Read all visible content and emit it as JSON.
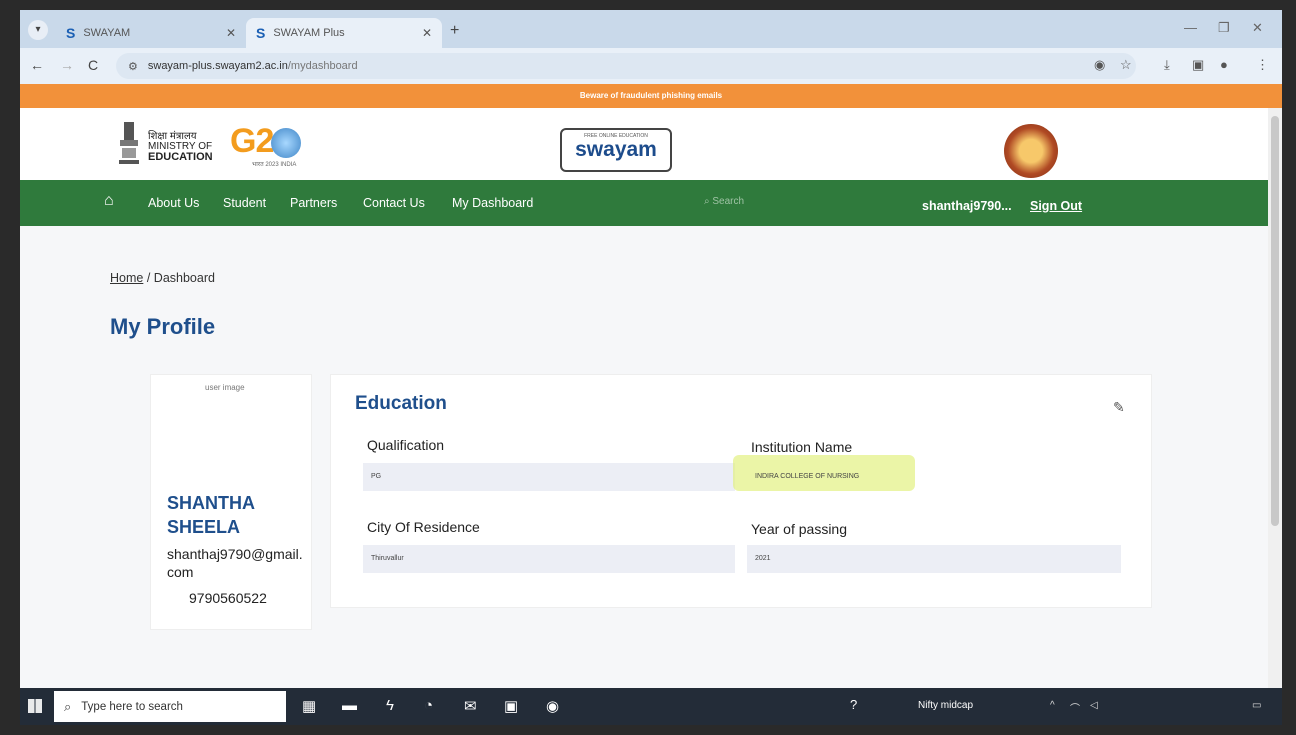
{
  "browser": {
    "tabs": [
      {
        "favicon": "S",
        "title": "SWAYAM"
      },
      {
        "favicon": "S",
        "title": "SWAYAM Plus"
      }
    ],
    "new_tab": "+",
    "url_host": "swayam-plus.swayam2.ac.in",
    "url_path": "/mydashboard"
  },
  "banner": {
    "text": "Beware of fraudulent phishing emails"
  },
  "header": {
    "ministry_hindi": "शिक्षा मंत्रालय",
    "ministry_line1": "MINISTRY OF",
    "ministry_line2": "EDUCATION",
    "g20": "G2",
    "g20_sub": "भारत 2023 INDIA",
    "swayam_tagline": "FREE ONLINE EDUCATION",
    "swayam": "swayam"
  },
  "nav": {
    "items": [
      "About Us",
      "Student",
      "Partners",
      "Contact Us",
      "My Dashboard"
    ],
    "search_placeholder": "Search",
    "user": "shanthaj9790...",
    "signout": "Sign Out"
  },
  "breadcrumb": {
    "home": "Home",
    "sep": "/",
    "current": "Dashboard"
  },
  "page_title": "My Profile",
  "profile": {
    "image_alt": "user image",
    "first_name": "SHANTHA",
    "last_name": "SHEELA",
    "email": "shanthaj9790@gmail.com",
    "phone": "9790560522"
  },
  "education": {
    "title": "Education",
    "fields": {
      "qualification": {
        "label": "Qualification",
        "value": "PG"
      },
      "institution": {
        "label": "Institution Name",
        "value": "INDIRA COLLEGE OF NURSING"
      },
      "city": {
        "label": "City Of Residence",
        "value": "Thiruvallur"
      },
      "year": {
        "label": "Year of passing",
        "value": "2021"
      }
    }
  },
  "taskbar": {
    "search_placeholder": "Type here to search",
    "ticker": "Nifty midcap"
  }
}
